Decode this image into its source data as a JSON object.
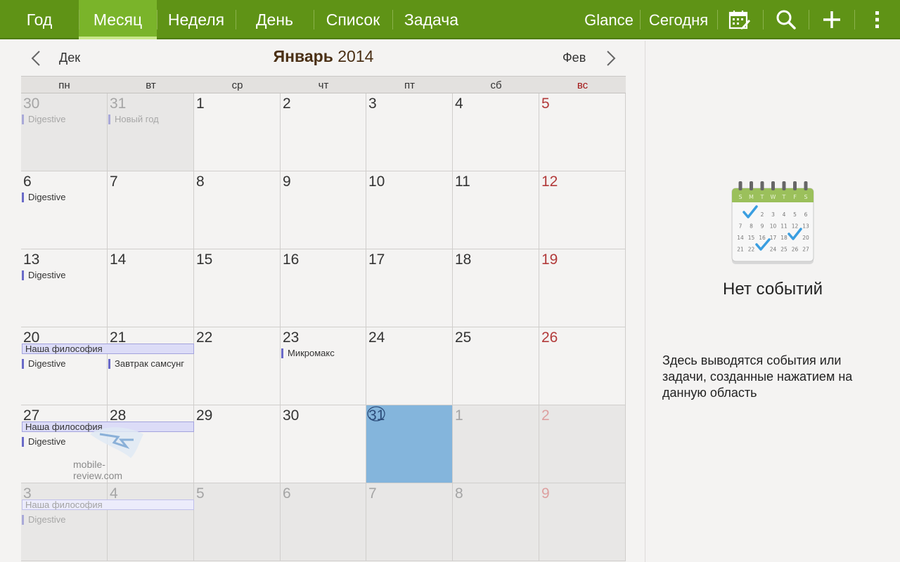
{
  "toolbar": {
    "tabs": [
      "Год",
      "Месяц",
      "Неделя",
      "День",
      "Список",
      "Задача"
    ],
    "glance": "Glance",
    "today": "Сегодня"
  },
  "header": {
    "prev_month": "Дек",
    "next_month": "Фев",
    "month_name": "Январь",
    "year": "2014"
  },
  "weekdays": [
    "пн",
    "вт",
    "ср",
    "чт",
    "пт",
    "сб",
    "вс"
  ],
  "weeks": [
    [
      {
        "day": "30",
        "other": true,
        "events": [
          "Digestive"
        ]
      },
      {
        "day": "31",
        "other": true,
        "events": [
          "Новый год"
        ]
      },
      {
        "day": "1",
        "events": []
      },
      {
        "day": "2",
        "events": []
      },
      {
        "day": "3",
        "events": []
      },
      {
        "day": "4",
        "events": []
      },
      {
        "day": "5",
        "events": []
      }
    ],
    [
      {
        "day": "6",
        "events": [
          "Digestive"
        ]
      },
      {
        "day": "7",
        "events": []
      },
      {
        "day": "8",
        "events": []
      },
      {
        "day": "9",
        "events": []
      },
      {
        "day": "10",
        "events": []
      },
      {
        "day": "11",
        "events": []
      },
      {
        "day": "12",
        "events": []
      }
    ],
    [
      {
        "day": "13",
        "events": [
          "Digestive"
        ]
      },
      {
        "day": "14",
        "events": []
      },
      {
        "day": "15",
        "events": []
      },
      {
        "day": "16",
        "events": []
      },
      {
        "day": "17",
        "events": []
      },
      {
        "day": "18",
        "events": []
      },
      {
        "day": "19",
        "events": []
      }
    ],
    [
      {
        "day": "20",
        "events": [
          "Digestive"
        ]
      },
      {
        "day": "21",
        "events": [
          "Завтрак самсунг"
        ]
      },
      {
        "day": "22",
        "events": []
      },
      {
        "day": "23",
        "events": [
          "Микромакс"
        ]
      },
      {
        "day": "24",
        "events": []
      },
      {
        "day": "25",
        "events": []
      },
      {
        "day": "26",
        "events": []
      }
    ],
    [
      {
        "day": "27",
        "events": [
          "Digestive"
        ]
      },
      {
        "day": "28",
        "events": []
      },
      {
        "day": "29",
        "events": []
      },
      {
        "day": "30",
        "events": []
      },
      {
        "day": "31",
        "today": true,
        "events": []
      },
      {
        "day": "1",
        "other": true,
        "events": []
      },
      {
        "day": "2",
        "other": true,
        "events": []
      }
    ],
    [
      {
        "day": "3",
        "other": true,
        "events": [
          "Digestive"
        ]
      },
      {
        "day": "4",
        "other": true,
        "events": []
      },
      {
        "day": "5",
        "other": true,
        "events": []
      },
      {
        "day": "6",
        "other": true,
        "events": []
      },
      {
        "day": "7",
        "other": true,
        "events": []
      },
      {
        "day": "8",
        "other": true,
        "events": []
      },
      {
        "day": "9",
        "other": true,
        "events": []
      }
    ]
  ],
  "multi_day_events": [
    {
      "title": "Наша философия",
      "week": 3,
      "start_col": 0,
      "span": 2
    },
    {
      "title": "Наша философия",
      "week": 4,
      "start_col": 0,
      "span": 2
    },
    {
      "title": "Наша философия",
      "week": 5,
      "start_col": 0,
      "span": 2,
      "dim": true
    }
  ],
  "watermark": "mobile-review.com",
  "right_panel": {
    "no_events": "Нет событий",
    "hint": "Здесь выводятся события или задачи, созданные нажатием на данную область",
    "illustration_letters": [
      "S",
      "M",
      "T",
      "W",
      "T",
      "F",
      "S"
    ],
    "illustration_numbers": [
      [
        "",
        "",
        "2",
        "3",
        "4",
        "5",
        "6"
      ],
      [
        "7",
        "8",
        "9",
        "10",
        "11",
        "12",
        "13"
      ],
      [
        "14",
        "15",
        "16",
        "17",
        "18",
        "",
        "20"
      ],
      [
        "21",
        "22",
        "",
        "24",
        "25",
        "26",
        "27"
      ]
    ]
  },
  "colors": {
    "toolbar": "#5f9316",
    "active_tab": "#7ab42a",
    "today_cell": "#84b5dc",
    "event_marker": "#6a6ac8",
    "sunday": "#b23a3a"
  }
}
